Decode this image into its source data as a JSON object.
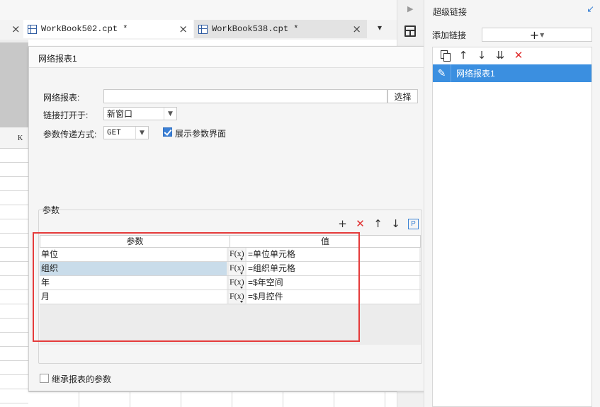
{
  "tabs": [
    {
      "label": "WorkBook502.cpt *",
      "active": true
    },
    {
      "label": "WorkBook538.cpt *",
      "active": false
    }
  ],
  "sheet": {
    "column_label": "K"
  },
  "dialog": {
    "title": "网络报表1",
    "report_label": "网络报表:",
    "report_value": "",
    "choose_button": "选择",
    "open_in_label": "链接打开于:",
    "open_in_value": "新窗口",
    "param_method_label": "参数传递方式:",
    "param_method_value": "GET",
    "show_params_label": "展示参数界面",
    "show_params_checked": true,
    "params_group_label": "参数",
    "params_table": {
      "headers": [
        "参数",
        "值"
      ],
      "rows": [
        {
          "name": "单位",
          "fx": "F(x)",
          "value": "=单位单元格",
          "selected": false
        },
        {
          "name": "组织",
          "fx": "F(x)",
          "value": "=组织单元格",
          "selected": true
        },
        {
          "name": "年",
          "fx": "F(x)",
          "value": "=$年空间",
          "selected": false
        },
        {
          "name": "月",
          "fx": "F(x)",
          "value": "=$月控件",
          "selected": false
        }
      ]
    },
    "toolbar_icons": [
      "plus-icon",
      "delete-icon",
      "arrow-up-icon",
      "arrow-down-icon",
      "param-p-icon"
    ],
    "param_p_label": "P",
    "inherit_label": "继承报表的参数",
    "inherit_checked": false
  },
  "right_panel": {
    "title": "超级链接",
    "add_label": "添加链接",
    "items": [
      {
        "label": "网络报表1",
        "selected": true
      }
    ]
  },
  "colors": {
    "accent_blue": "#3b8fe0",
    "highlight_red": "#e53b3b",
    "selected_row": "#c9dcea",
    "delete_red": "#e03030"
  }
}
